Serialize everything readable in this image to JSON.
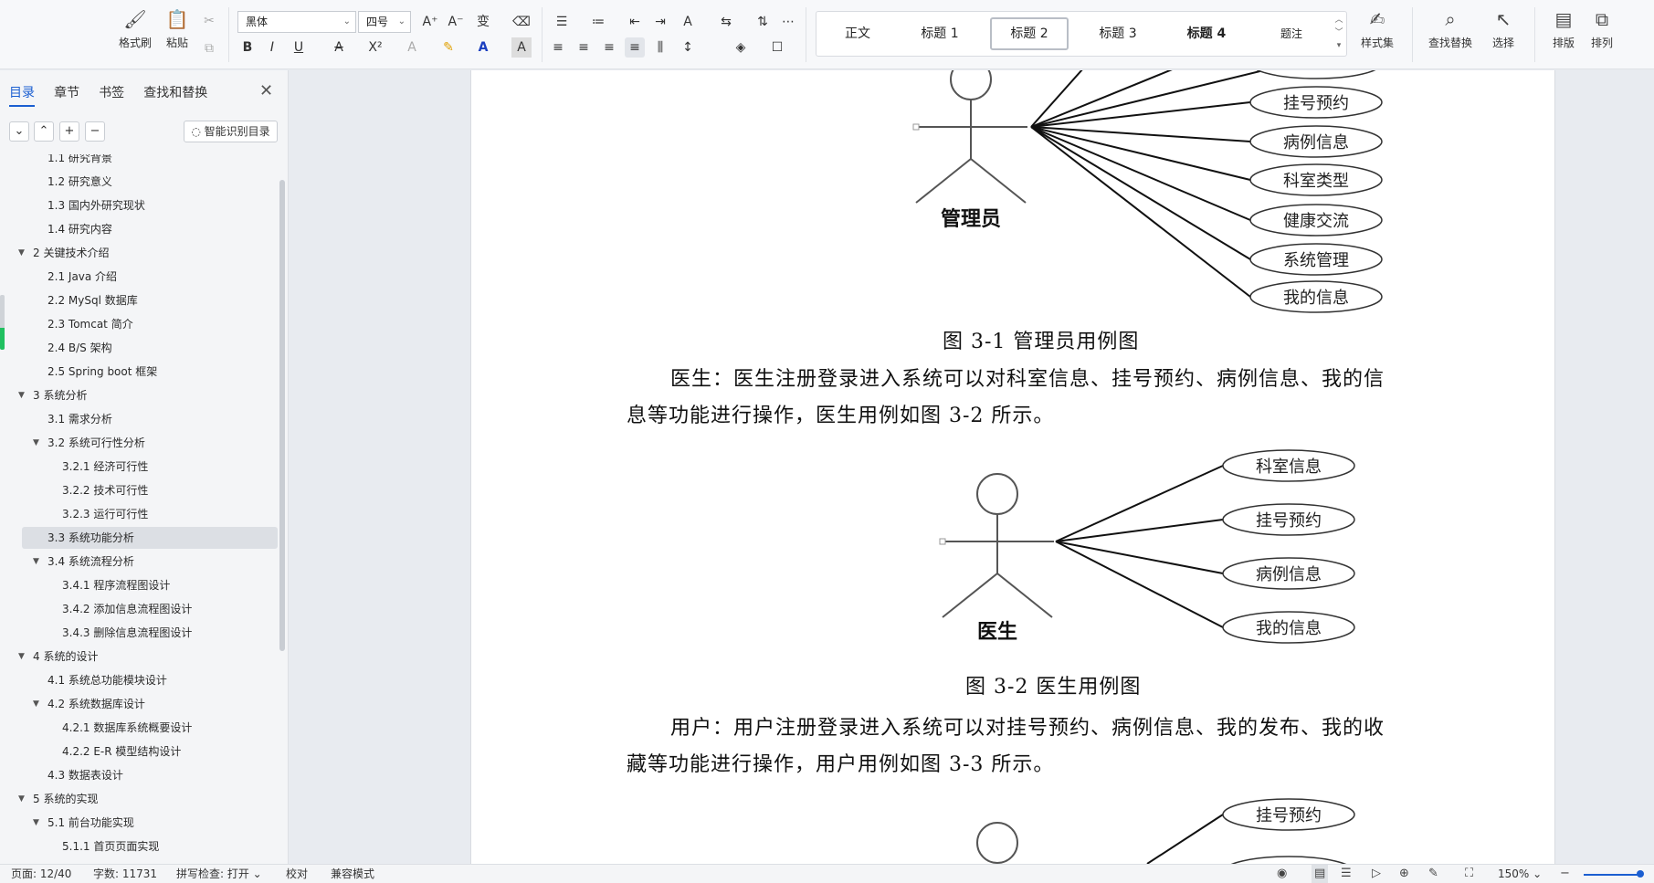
{
  "ribbon": {
    "clipboard": {
      "format_painter": "格式刷",
      "paste": "粘贴"
    },
    "font_name": "黑体",
    "font_size": "四号",
    "styles": [
      "正文",
      "标题 1",
      "标题 2",
      "标题 3",
      "标题 4",
      "题注"
    ],
    "selected_style": "标题 2",
    "style_set": "样式集",
    "find_replace": "查找替换",
    "select": "选择",
    "layout": "排版",
    "arrange": "排列"
  },
  "nav": {
    "tabs": [
      "目录",
      "章节",
      "书签",
      "查找和替换"
    ],
    "active_tab": "目录",
    "smart_toc": "智能识别目录",
    "toc": [
      {
        "text": "1.1  研究背景",
        "level": 2,
        "expander": false
      },
      {
        "text": "1.2  研究意义",
        "level": 2,
        "expander": false
      },
      {
        "text": "1.3  国内外研究现状",
        "level": 2,
        "expander": false
      },
      {
        "text": "1.4  研究内容",
        "level": 2,
        "expander": false
      },
      {
        "text": "2    关键技术介绍",
        "level": 1,
        "expander": true
      },
      {
        "text": "2.1 Java 介绍",
        "level": 2,
        "expander": false
      },
      {
        "text": "2.2 MySql 数据库",
        "level": 2,
        "expander": false
      },
      {
        "text": "2.3 Tomcat 简介",
        "level": 2,
        "expander": false
      },
      {
        "text": "2.4 B/S 架构",
        "level": 2,
        "expander": false
      },
      {
        "text": "2.5 Spring boot 框架",
        "level": 2,
        "expander": false
      },
      {
        "text": "3    系统分析",
        "level": 1,
        "expander": true
      },
      {
        "text": "3.1 需求分析",
        "level": 2,
        "expander": false
      },
      {
        "text": "3.2  系统可行性分析",
        "level": 2,
        "expander": true
      },
      {
        "text": "3.2.1 经济可行性",
        "level": 3,
        "expander": false
      },
      {
        "text": "3.2.2 技术可行性",
        "level": 3,
        "expander": false
      },
      {
        "text": "3.2.3 运行可行性",
        "level": 3,
        "expander": false
      },
      {
        "text": "3.3  系统功能分析",
        "level": 2,
        "expander": false,
        "selected": true
      },
      {
        "text": "3.4  系统流程分析",
        "level": 2,
        "expander": true
      },
      {
        "text": "3.4.1 程序流程图设计",
        "level": 3,
        "expander": false
      },
      {
        "text": "3.4.2 添加信息流程图设计",
        "level": 3,
        "expander": false
      },
      {
        "text": "3.4.3 删除信息流程图设计",
        "level": 3,
        "expander": false
      },
      {
        "text": "4    系统的设计",
        "level": 1,
        "expander": true
      },
      {
        "text": "4.1  系统总功能模块设计",
        "level": 2,
        "expander": false
      },
      {
        "text": "4.2  系统数据库设计",
        "level": 2,
        "expander": true
      },
      {
        "text": "4.2.1  数据库系统概要设计",
        "level": 3,
        "expander": false
      },
      {
        "text": "4.2.2 E-R 模型结构设计",
        "level": 3,
        "expander": false
      },
      {
        "text": "4.3 数据表设计",
        "level": 2,
        "expander": false
      },
      {
        "text": "5    系统的实现",
        "level": 1,
        "expander": true
      },
      {
        "text": "5.1 前台功能实现",
        "level": 2,
        "expander": true
      },
      {
        "text": "5.1.1 首页页面实现",
        "level": 3,
        "expander": false
      }
    ]
  },
  "doc": {
    "diagram1": {
      "actor": "管理员",
      "use_cases": [
        "挂号预约",
        "病例信息",
        "科室类型",
        "健康交流",
        "系统管理",
        "我的信息"
      ],
      "caption": "图 3-1  管理员用例图"
    },
    "para1_line1": "医生：医生注册登录进入系统可以对科室信息、挂号预约、病例信息、我的信",
    "para1_line2": "息等功能进行操作，医生用例如图 3-2 所示。",
    "diagram2": {
      "actor": "医生",
      "use_cases": [
        "科室信息",
        "挂号预约",
        "病例信息",
        "我的信息"
      ],
      "caption": "图 3-2 医生用例图"
    },
    "para2_line1": "用户：用户注册登录进入系统可以对挂号预约、病例信息、我的发布、我的收",
    "para2_line2": "藏等功能进行操作，用户用例如图 3-3 所示。",
    "diagram3": {
      "use_cases": [
        "挂号预约"
      ]
    }
  },
  "status": {
    "page": "页面: 12/40",
    "words": "字数: 11731",
    "spell": "拼写检查: 打开",
    "proof": "校对",
    "compat": "兼容模式",
    "zoom": "150%"
  }
}
